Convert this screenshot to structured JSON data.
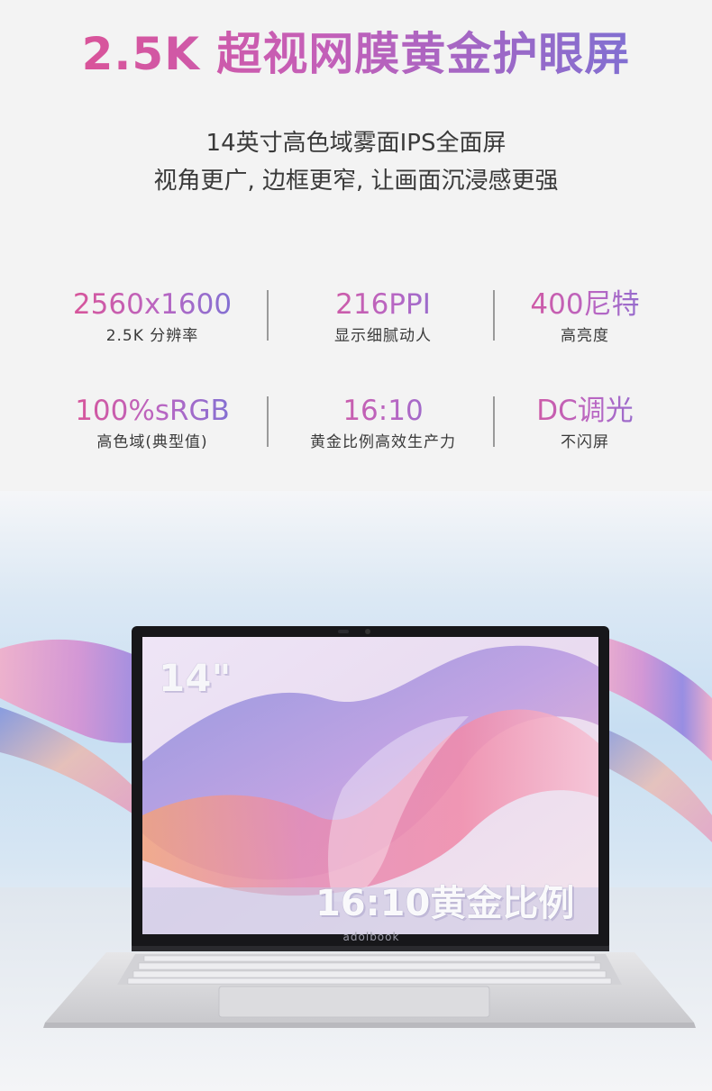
{
  "headline": "2.5K 超视网膜黄金护眼屏",
  "subtitle": {
    "line1": "14英寸高色域雾面IPS全面屏",
    "line2": "视角更广, 边框更窄, 让画面沉浸感更强"
  },
  "specs": [
    {
      "value": "2560x1600",
      "label": "2.5K 分辨率"
    },
    {
      "value": "216PPI",
      "label": "显示细腻动人"
    },
    {
      "value": "400尼特",
      "label": "高亮度"
    },
    {
      "value": "100%sRGB",
      "label": "高色域(典型值)"
    },
    {
      "value": "16:10",
      "label": "黄金比例高效生产力"
    },
    {
      "value": "DC调光",
      "label": "不闪屏"
    }
  ],
  "screen": {
    "size_label": "14\"",
    "ratio_label": "16:10黄金比例",
    "brand": "adolbook"
  },
  "colors": {
    "gradient_start": "#e0508f",
    "gradient_end": "#6f73d8",
    "text": "#3a3a3a"
  }
}
